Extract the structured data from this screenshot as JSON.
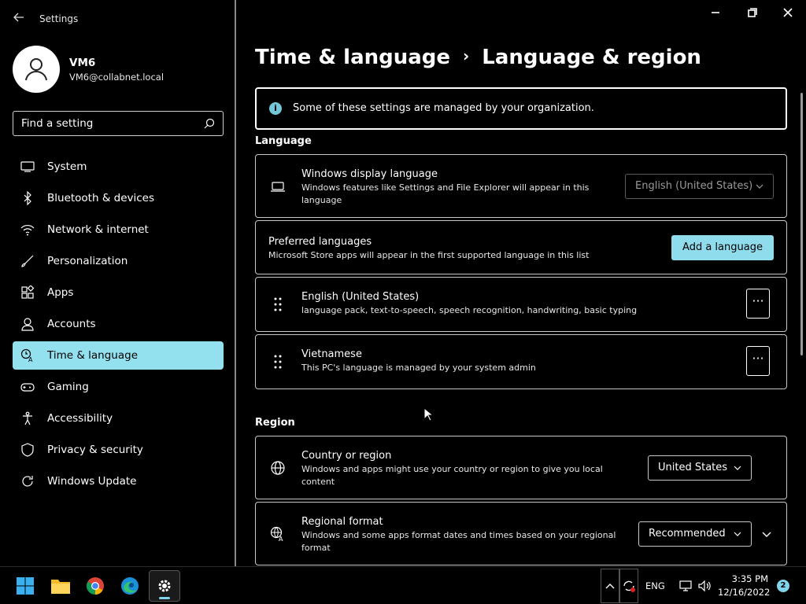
{
  "window": {
    "app_title": "Settings",
    "controls": {
      "minimize": "minimize-icon",
      "restore": "restore-icon",
      "close": "close-icon"
    }
  },
  "user": {
    "name": "VM6",
    "email": "VM6@collabnet.local"
  },
  "search": {
    "placeholder": "Find a setting"
  },
  "sidebar": {
    "items": [
      {
        "label": "System",
        "icon": "monitor-icon"
      },
      {
        "label": "Bluetooth & devices",
        "icon": "bluetooth-icon"
      },
      {
        "label": "Network & internet",
        "icon": "wifi-icon"
      },
      {
        "label": "Personalization",
        "icon": "brush-icon"
      },
      {
        "label": "Apps",
        "icon": "apps-icon"
      },
      {
        "label": "Accounts",
        "icon": "person-icon"
      },
      {
        "label": "Time & language",
        "icon": "time-language-icon",
        "active": true
      },
      {
        "label": "Gaming",
        "icon": "gamepad-icon"
      },
      {
        "label": "Accessibility",
        "icon": "accessibility-icon"
      },
      {
        "label": "Privacy & security",
        "icon": "shield-icon"
      },
      {
        "label": "Windows Update",
        "icon": "update-icon"
      }
    ]
  },
  "breadcrumb": {
    "parent": "Time & language",
    "separator": "›",
    "current": "Language & region"
  },
  "info_banner": {
    "text": "Some of these settings are managed by your organization.",
    "icon": "i"
  },
  "language": {
    "heading": "Language",
    "display_language": {
      "title": "Windows display language",
      "desc": "Windows features like Settings and File Explorer will appear in this language",
      "value": "English (United States)"
    },
    "preferred": {
      "title": "Preferred languages",
      "desc": "Microsoft Store apps will appear in the first supported language in this list",
      "button": "Add a language"
    },
    "list": [
      {
        "name": "English (United States)",
        "desc": "language pack, text-to-speech, speech recognition, handwriting, basic typing",
        "more": "···"
      },
      {
        "name": "Vietnamese",
        "desc": "This PC's language is managed by your system admin",
        "more": "···"
      }
    ]
  },
  "region": {
    "heading": "Region",
    "country": {
      "title": "Country or region",
      "desc": "Windows and apps might use your country or region to give you local content",
      "value": "United States"
    },
    "format": {
      "title": "Regional format",
      "desc": "Windows and some apps format dates and times based on your regional format",
      "value": "Recommended"
    }
  },
  "taskbar": {
    "apps": [
      "start-icon",
      "file-explorer-icon",
      "chrome-icon",
      "edge-icon",
      "settings-icon"
    ],
    "language": "ENG",
    "time": "3:35 PM",
    "date": "12/16/2022",
    "notifications": "2"
  },
  "colors": {
    "accent": "#93e0ef",
    "button": "#8fdcec",
    "info": "#71c8d8",
    "background": "#000000"
  }
}
